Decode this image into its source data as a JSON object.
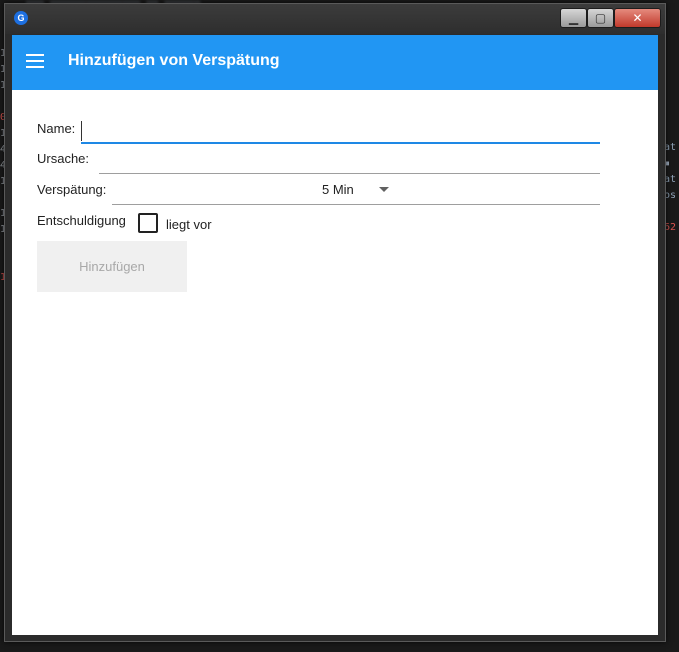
{
  "window": {
    "icon_letter": "G",
    "controls": {
      "minimize": "▁",
      "maximize": "▢",
      "close": "✕"
    }
  },
  "appbar": {
    "title": "Hinzufügen von Verspätung"
  },
  "form": {
    "name_label": "Name:",
    "name_value": "",
    "ursache_label": "Ursache:",
    "ursache_value": "",
    "verspaetung_label": "Verspätung:",
    "verspaetung_value": "5 Min",
    "entschuldigung_label": "Entschuldigung",
    "checkbox_label": "liegt vor",
    "checkbox_checked": false,
    "submit_label": "Hinzufügen",
    "submit_disabled": true
  },
  "colors": {
    "appbar": "#2196f3",
    "focus_underline": "#1e88e5",
    "submit_bg": "#f0f0f0",
    "submit_text": "#a8a8a8"
  }
}
